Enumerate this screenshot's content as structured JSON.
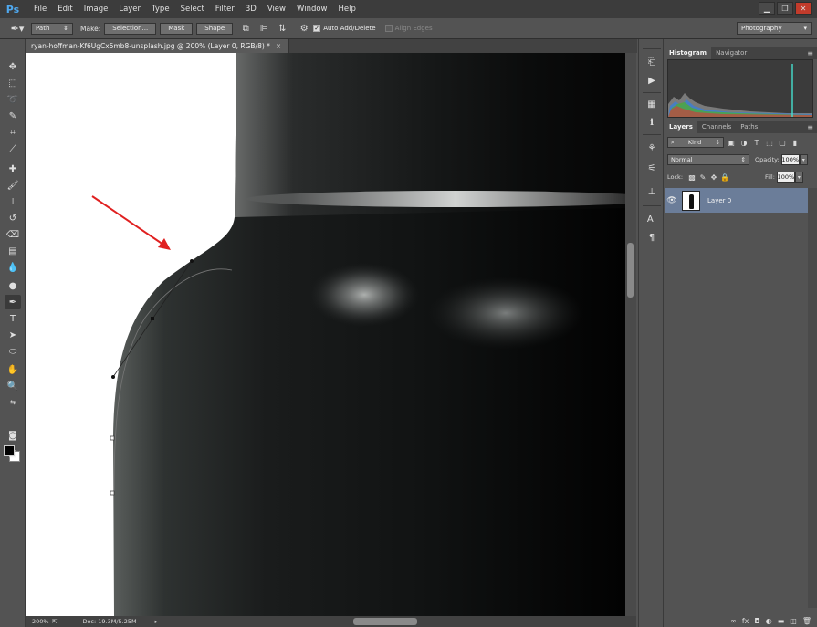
{
  "app": {
    "logo": "Ps"
  },
  "menu": [
    "File",
    "Edit",
    "Image",
    "Layer",
    "Type",
    "Select",
    "Filter",
    "3D",
    "View",
    "Window",
    "Help"
  ],
  "window_controls": {
    "minimize": "▁",
    "maximize": "❐",
    "close": "✕"
  },
  "options_bar": {
    "mode": "Path",
    "make_label": "Make:",
    "buttons": [
      "Selection...",
      "Mask",
      "Shape"
    ],
    "auto_add_delete": "Auto Add/Delete",
    "align_edges": "Align Edges",
    "auto_add_checked": true,
    "align_edges_checked": false,
    "workspace": "Photography"
  },
  "document": {
    "tab_title": "ryan-hoffman-Kf6UgCx5mb8-unsplash.jpg @ 200% (Layer 0, RGB/8) *",
    "tab_close": "×"
  },
  "status": {
    "zoom": "200%",
    "doc_info": "Doc: 19.3M/5.25M"
  },
  "panels": {
    "top_tabs": [
      "Histogram",
      "Navigator"
    ],
    "layer_tabs": [
      "Layers",
      "Channels",
      "Paths"
    ],
    "kind": "Kind",
    "blend_mode": "Normal",
    "opacity_label": "Opacity:",
    "opacity_value": "100%",
    "lock_label": "Lock:",
    "fill_label": "Fill:",
    "fill_value": "100%",
    "layers": [
      {
        "name": "Layer 0",
        "visible": true,
        "selected": true
      }
    ]
  },
  "colors": {
    "accent_blue": "#4fa9f0",
    "selected_layer": "#6b7d99",
    "annotation_arrow": "#e02020",
    "foreground": "#000000",
    "background": "#ffffff"
  }
}
